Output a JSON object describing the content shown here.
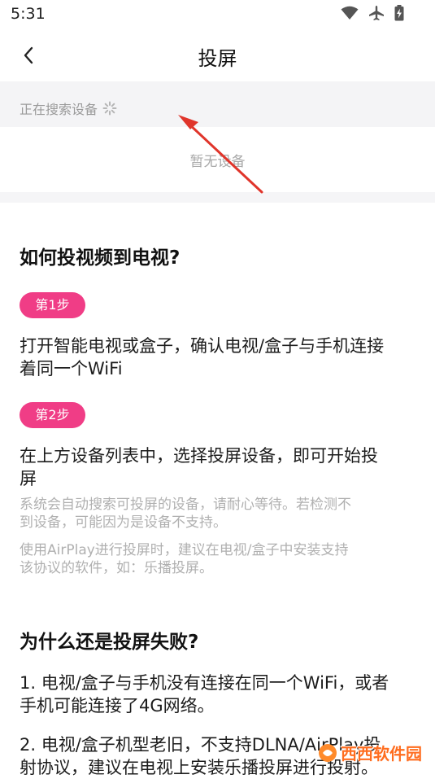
{
  "status_bar": {
    "time": "5:31",
    "icons": [
      "wifi-icon",
      "airplane-icon",
      "battery-charging-icon"
    ]
  },
  "nav": {
    "back_icon": "chevron-left-icon",
    "title": "投屏"
  },
  "search": {
    "status": "正在搜索设备",
    "empty": "暂无设备"
  },
  "guide": {
    "heading": "如何投视频到电视?",
    "step1_badge": "第1步",
    "step1_line1": "打开智能电视或盒子，确认电视/盒子与手机连接",
    "step1_line2": "着同一个WiFi",
    "step2_badge": "第2步",
    "step2_line1": "在上方设备列表中，选择投屏设备，即可开始投",
    "step2_line2": "屏",
    "note1_line1": "系统会自动搜索可投屏的设备，请耐心等待。若检测不",
    "note1_line2": "到设备，可能因为是设备不支持。",
    "note2_line1": "使用AirPlay进行投屏时，建议在电视/盒子中安装支持",
    "note2_line2": "该协议的软件，如：乐播投屏。"
  },
  "faq": {
    "heading": "为什么还是投屏失败?",
    "reason1_line1": "1. 电视/盒子与手机没有连接在同一个WiFi，或者",
    "reason1_line2": "手机可能连接了4G网络。",
    "reason2_line1": "2. 电视/盒子机型老旧，不支持DLNA/AirPlay投",
    "reason2_line2": "射协议，建议在电视上安装乐播投屏进行投射。"
  },
  "watermark": {
    "text": "西西软件园"
  },
  "colors": {
    "accent": "#f03d86",
    "arrow": "#e0352b",
    "muted_text": "#b0b0b0",
    "strip_bg": "#f4f4f6"
  }
}
